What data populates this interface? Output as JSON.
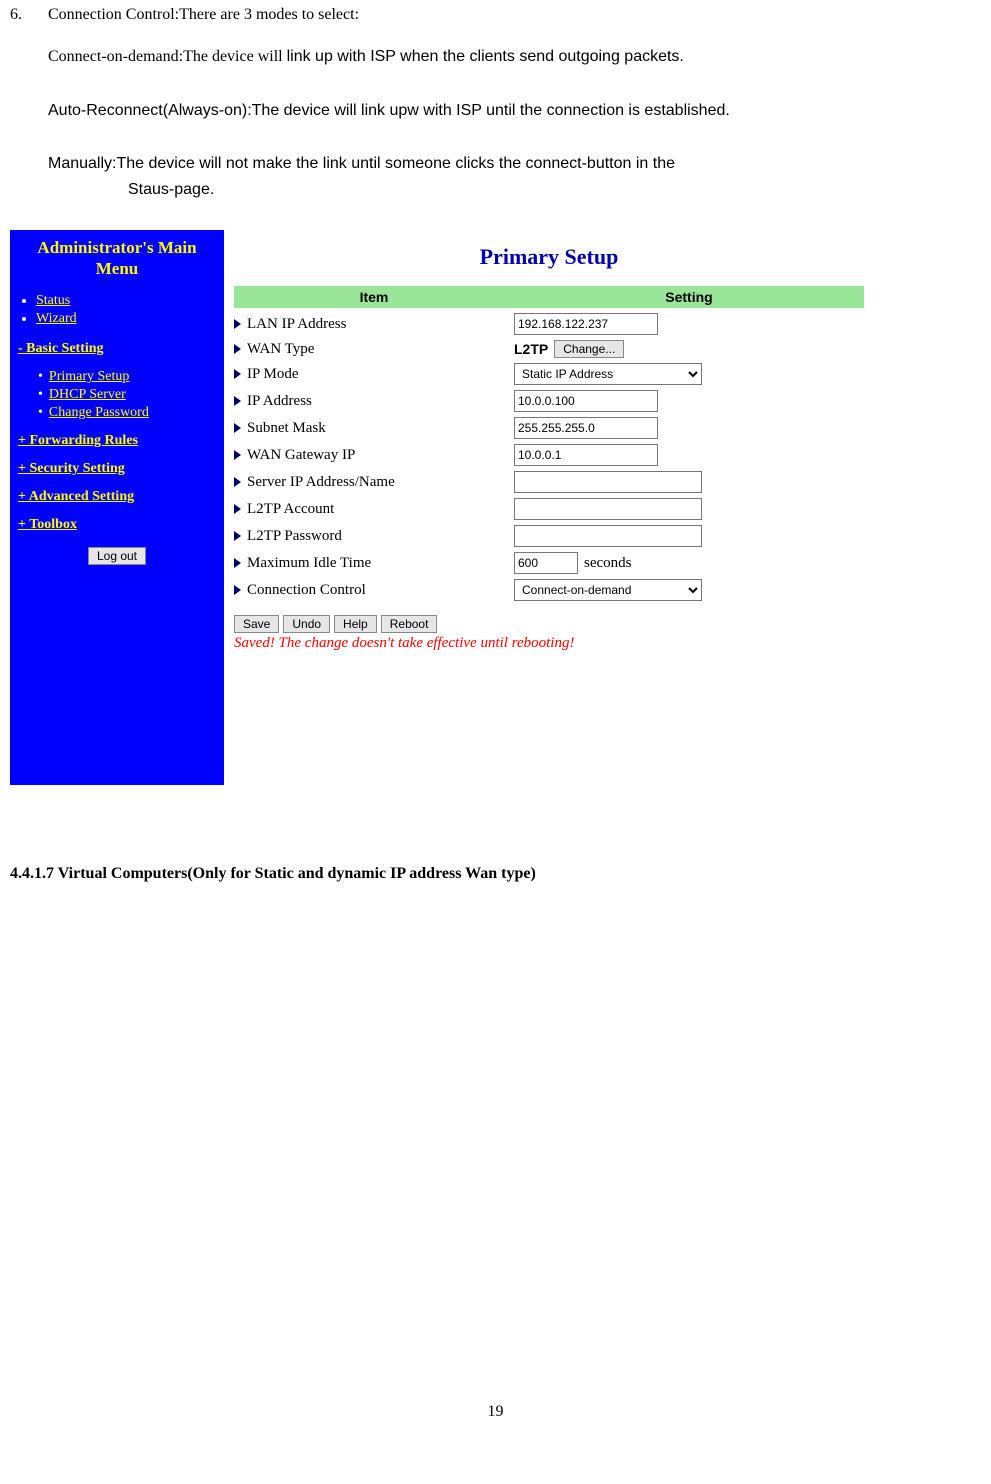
{
  "doc": {
    "item_number": "6.",
    "item_title": "Connection Control:There are 3 modes to select:",
    "cod_label": "Connect-on-demand:The device will ",
    "cod_rest": "link up with ISP when the clients send outgoing packets.",
    "auto_label": "Auto-Reconnect(Always-on):The device will link upw with ISP until the connection is established.",
    "manual_line1": "Manually:The device will not make the link until someone clicks the connect-button in the",
    "manual_line2": "Staus-page.",
    "section_heading": "4.4.1.7 Virtual Computers(Only for Static and dynamic IP address Wan type)",
    "page_number": "19"
  },
  "sidebar": {
    "title": "Administrator's Main Menu",
    "status": "Status",
    "wizard": "Wizard",
    "basic": "- Basic Setting",
    "primary_setup": "Primary Setup",
    "dhcp_server": "DHCP Server",
    "change_password": "Change Password",
    "forwarding": "+ Forwarding Rules",
    "security": "+ Security Setting",
    "advanced": "+ Advanced Setting",
    "toolbox": "+ Toolbox",
    "logout": "Log out"
  },
  "content": {
    "title": "Primary Setup",
    "hdr_item": "Item",
    "hdr_setting": "Setting",
    "rows": {
      "lan_ip_lbl": "LAN IP Address",
      "lan_ip_val": "192.168.122.237",
      "wan_type_lbl": "WAN Type",
      "wan_type_prefix": "L2TP",
      "wan_type_btn": "Change...",
      "ip_mode_lbl": "IP Mode",
      "ip_mode_val": "Static IP Address",
      "ip_addr_lbl": "IP Address",
      "ip_addr_val": "10.0.0.100",
      "subnet_lbl": "Subnet Mask",
      "subnet_val": "255.255.255.0",
      "gateway_lbl": "WAN Gateway IP",
      "gateway_val": "10.0.0.1",
      "server_lbl": "Server IP Address/Name",
      "server_val": "",
      "acct_lbl": "L2TP Account",
      "acct_val": "",
      "pwd_lbl": "L2TP Password",
      "pwd_val": "",
      "idle_lbl": "Maximum Idle Time",
      "idle_val": "600",
      "idle_unit": "seconds",
      "conn_lbl": "Connection Control",
      "conn_val": "Connect-on-demand"
    },
    "buttons": {
      "save": "Save",
      "undo": "Undo",
      "help": "Help",
      "reboot": "Reboot"
    },
    "saved_msg": "Saved! The change doesn't take effective until rebooting!"
  }
}
